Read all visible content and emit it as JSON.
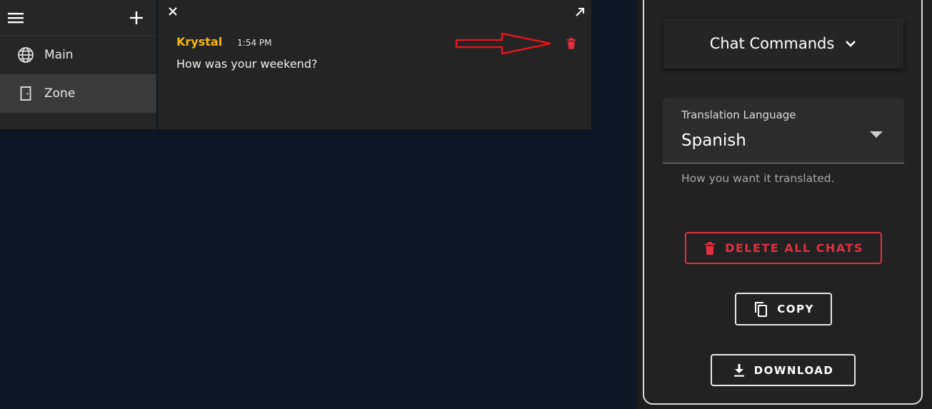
{
  "sidebar": {
    "menu_icon": "menu-icon",
    "add_icon": "plus-icon",
    "items": [
      {
        "label": "Main",
        "icon": "globe-icon",
        "active": false
      },
      {
        "label": "Zone",
        "icon": "door-icon",
        "active": true
      }
    ]
  },
  "chat": {
    "close_icon": "close-icon",
    "expand_icon": "expand-arrow-icon",
    "message": {
      "author": "Krystal",
      "time": "1:54 PM",
      "text": "How was your weekend?"
    },
    "delete_icon": "trash-icon"
  },
  "panel": {
    "commands_title": "Chat Commands",
    "translation": {
      "label": "Translation Language",
      "value": "Spanish",
      "helper": "How you want it translated."
    },
    "buttons": {
      "delete_all": "DELETE ALL CHATS",
      "copy": "COPY",
      "download": "DOWNLOAD"
    }
  },
  "colors": {
    "background": "#0e1626",
    "author": "#f5b800",
    "danger": "#e0303f",
    "annotation_arrow": "#e0141e"
  }
}
